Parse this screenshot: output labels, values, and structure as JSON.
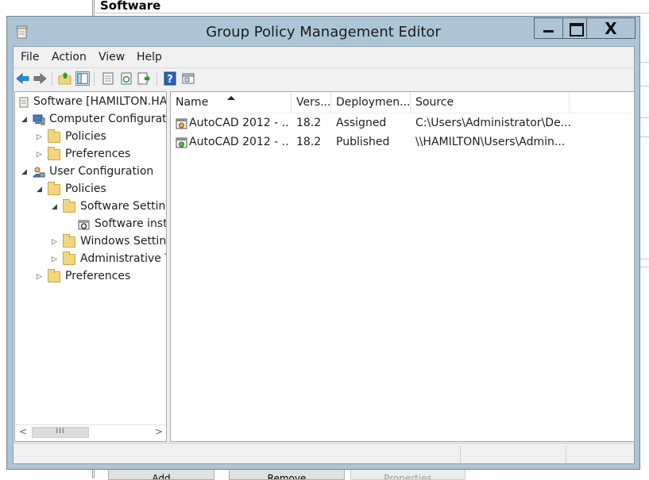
{
  "background_window": {
    "header_title": "Software",
    "buttons": [
      {
        "label": "Add",
        "enabled": true
      },
      {
        "label": "Remove",
        "enabled": true
      },
      {
        "label": "Properties",
        "enabled": false
      }
    ]
  },
  "window": {
    "title": "Group Policy Management Editor",
    "controls": {
      "minimize": "minimize",
      "maximize": "maximize",
      "close": "X"
    }
  },
  "menu": [
    "File",
    "Action",
    "View",
    "Help"
  ],
  "toolbar": {
    "icons": [
      "back-arrow-icon",
      "forward-arrow-icon",
      "up-folder-icon",
      "show-hide-tree-icon",
      "properties-icon",
      "refresh-icon",
      "export-list-icon",
      "help-icon",
      "show-pane-icon"
    ]
  },
  "tree": {
    "nodes": [
      {
        "label": "Software [HAMILTON.HA",
        "level": 0,
        "expander": "",
        "icon": "gpo-scroll-icon"
      },
      {
        "label": "Computer Configuratic",
        "level": 1,
        "expander": "expanded",
        "icon": "computer-icon"
      },
      {
        "label": "Policies",
        "level": 2,
        "expander": "collapsed",
        "icon": "folder-icon"
      },
      {
        "label": "Preferences",
        "level": 2,
        "expander": "collapsed",
        "icon": "folder-icon"
      },
      {
        "label": "User Configuration",
        "level": 1,
        "expander": "expanded",
        "icon": "users-icon"
      },
      {
        "label": "Policies",
        "level": 2,
        "expander": "expanded",
        "icon": "folder-icon"
      },
      {
        "label": "Software Setting",
        "level": 3,
        "expander": "expanded",
        "icon": "folder-icon"
      },
      {
        "label": "Software insta",
        "level": 4,
        "expander": "",
        "icon": "software-installation-icon"
      },
      {
        "label": "Windows Setting",
        "level": 3,
        "expander": "collapsed",
        "icon": "folder-icon"
      },
      {
        "label": "Administrative T",
        "level": 3,
        "expander": "collapsed",
        "icon": "folder-icon"
      },
      {
        "label": "Preferences",
        "level": 2,
        "expander": "collapsed",
        "icon": "folder-icon"
      }
    ],
    "scrollbar": {
      "thumb": "III",
      "left": "<",
      "right": ">"
    }
  },
  "list": {
    "columns": [
      "Name",
      "Vers...",
      "Deploymen...",
      "Source"
    ],
    "sorted_column": "Name",
    "rows": [
      {
        "name": "AutoCAD 2012 - ...",
        "version": "18.2",
        "deployment": "Assigned",
        "source": "C:\\Users\\Administrator\\De...",
        "icon": "assigned-package-icon"
      },
      {
        "name": "AutoCAD 2012 - ...",
        "version": "18.2",
        "deployment": "Published",
        "source": "\\\\HAMILTON\\Users\\Admin...",
        "icon": "published-package-icon"
      }
    ]
  },
  "colors": {
    "window_frame": "#adc5d4",
    "selection": "#cce4f7",
    "folder": "#f2d67e"
  }
}
